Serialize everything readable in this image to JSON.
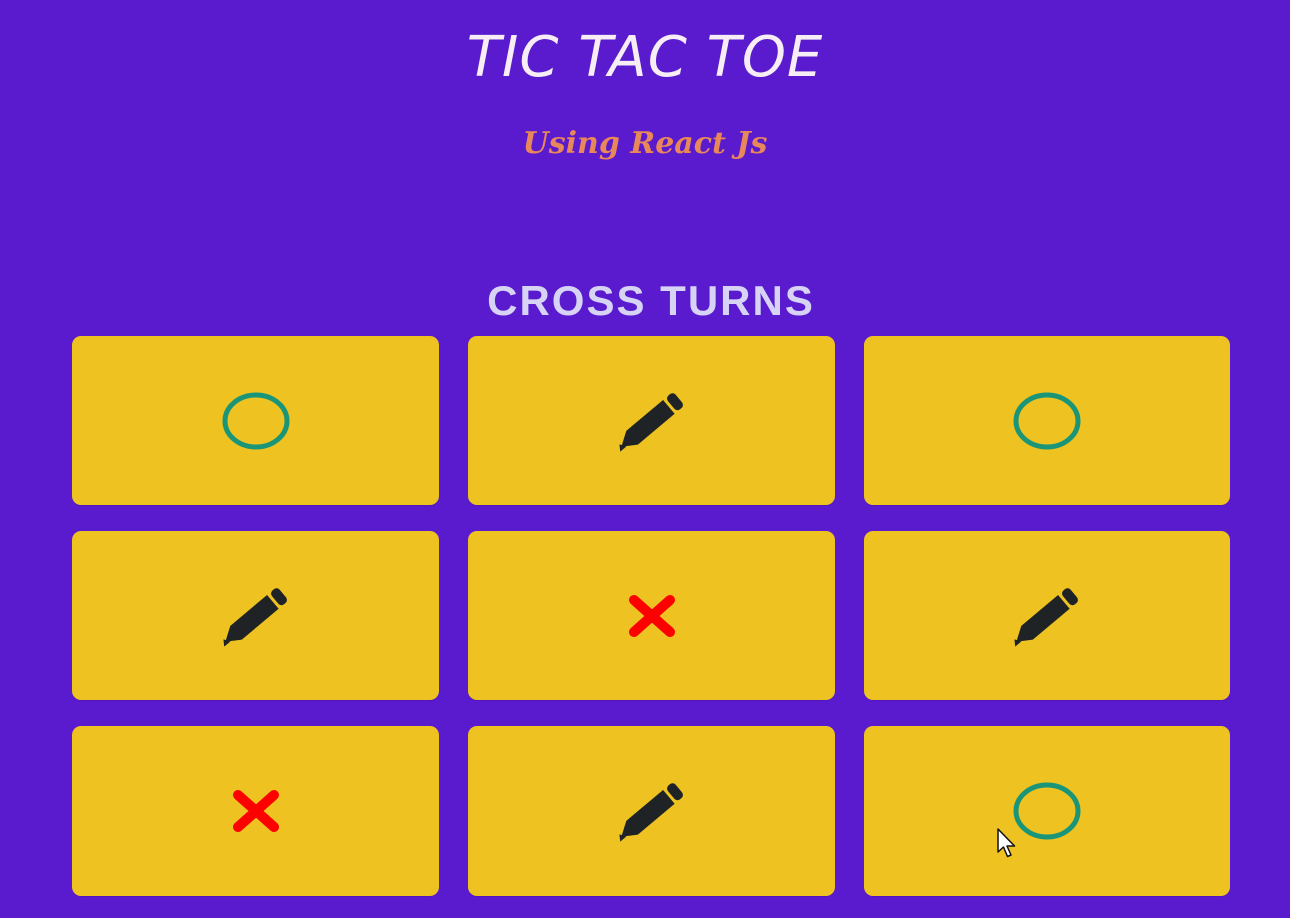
{
  "header": {
    "title": "TIC TAC TOE",
    "subtitle": "Using React Js"
  },
  "status": {
    "text": "CROSS TURNS"
  },
  "board": {
    "cells": [
      {
        "state": "circle",
        "icon": "circle-icon"
      },
      {
        "state": "empty",
        "icon": "pencil-icon"
      },
      {
        "state": "circle",
        "icon": "circle-icon"
      },
      {
        "state": "empty",
        "icon": "pencil-icon"
      },
      {
        "state": "cross",
        "icon": "cross-icon"
      },
      {
        "state": "empty",
        "icon": "pencil-icon"
      },
      {
        "state": "cross",
        "icon": "cross-icon"
      },
      {
        "state": "empty",
        "icon": "pencil-icon"
      },
      {
        "state": "circle",
        "icon": "circle-icon"
      }
    ]
  },
  "colors": {
    "background": "#5a1acd",
    "cell": "#eec220",
    "circle": "#1a9578",
    "cross": "#ff0000",
    "pencil": "#1f2326",
    "title": "#f6eef4",
    "subtitle": "#e8875a",
    "status": "#d6d3f5"
  }
}
